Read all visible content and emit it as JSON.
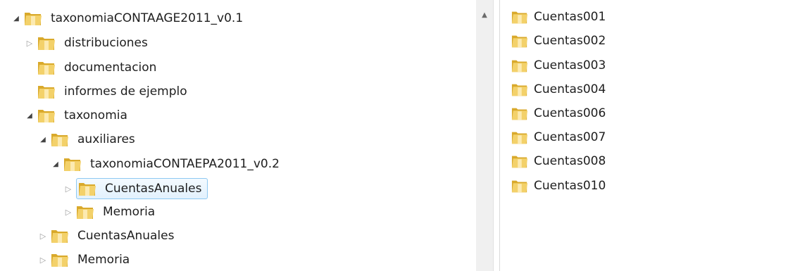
{
  "tree": {
    "items": [
      {
        "label": "taxonomiaCONTAAGE2011_v0.1",
        "toggle": "◢",
        "state": "expanded"
      },
      {
        "label": "distribuciones",
        "toggle": "▷",
        "state": "collapsed"
      },
      {
        "label": "documentacion",
        "toggle": "",
        "state": "leaf"
      },
      {
        "label": "informes de ejemplo",
        "toggle": "",
        "state": "leaf"
      },
      {
        "label": "taxonomia",
        "toggle": "◢",
        "state": "expanded"
      },
      {
        "label": "auxiliares",
        "toggle": "◢",
        "state": "expanded"
      },
      {
        "label": "taxonomiaCONTAEPA2011_v0.2",
        "toggle": "◢",
        "state": "expanded"
      },
      {
        "label": "CuentasAnuales",
        "toggle": "▷",
        "state": "collapsed",
        "selected": true
      },
      {
        "label": "Memoria",
        "toggle": "▷",
        "state": "collapsed"
      },
      {
        "label": "CuentasAnuales",
        "toggle": "▷",
        "state": "collapsed"
      },
      {
        "label": "Memoria",
        "toggle": "▷",
        "state": "collapsed"
      }
    ]
  },
  "scrollbar": {
    "up_arrow": "▲"
  },
  "list": {
    "items": [
      {
        "label": "Cuentas001"
      },
      {
        "label": "Cuentas002"
      },
      {
        "label": "Cuentas003"
      },
      {
        "label": "Cuentas004"
      },
      {
        "label": "Cuentas006"
      },
      {
        "label": "Cuentas007"
      },
      {
        "label": "Cuentas008"
      },
      {
        "label": "Cuentas010"
      }
    ]
  },
  "colors": {
    "selection_fill": "#e2f1fd",
    "selection_border": "#8ec9f2",
    "folder_back": "#d9a92b",
    "folder_front": "#f3d16a"
  }
}
